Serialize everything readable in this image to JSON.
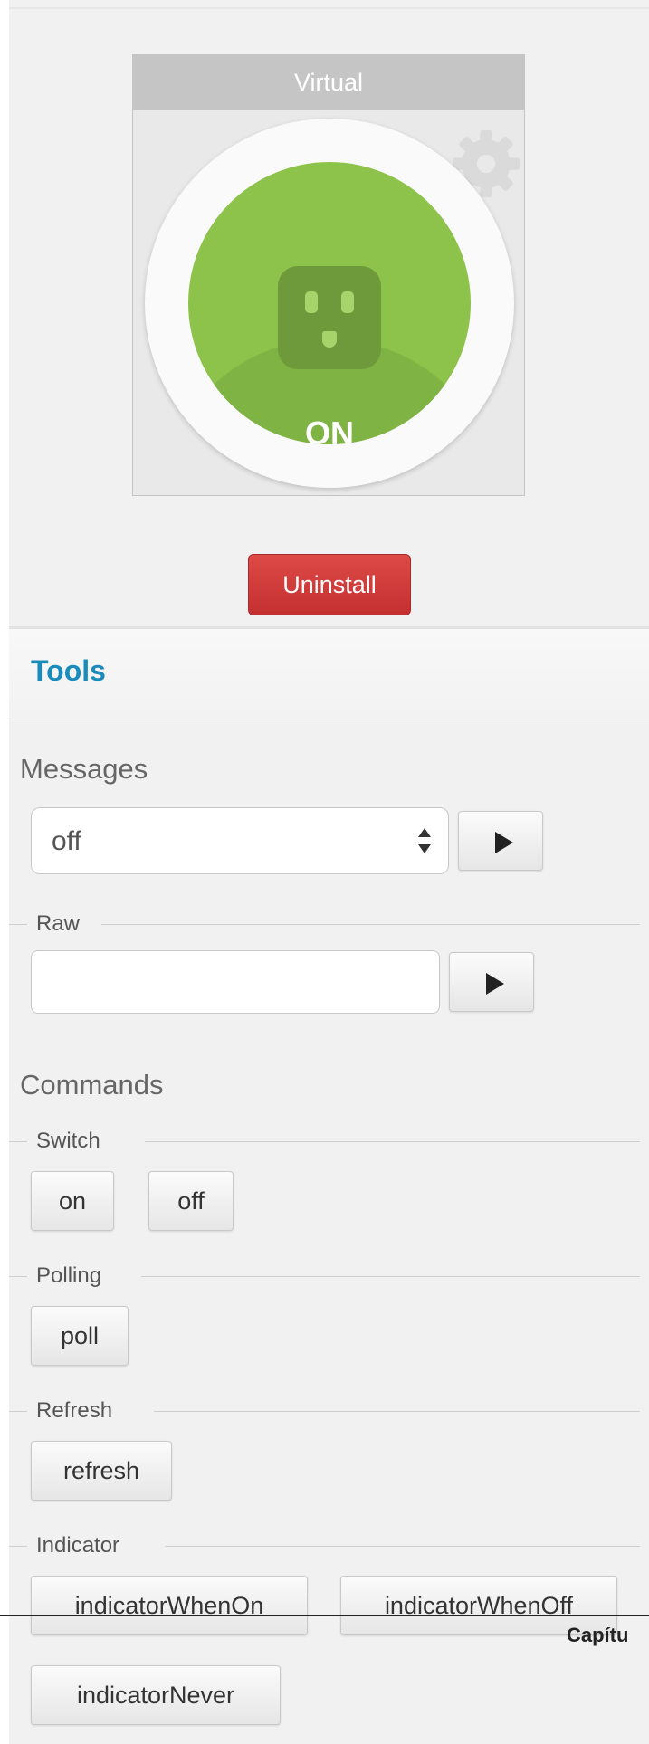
{
  "device_tile": {
    "label": "Virtual",
    "state": "ON"
  },
  "uninstall_label": "Uninstall",
  "tools": {
    "title": "Tools",
    "messages": {
      "heading": "Messages",
      "selected": "off",
      "raw_label": "Raw",
      "raw_value": ""
    },
    "commands": {
      "heading": "Commands",
      "groups": [
        {
          "label": "Switch",
          "buttons": [
            "on",
            "off"
          ]
        },
        {
          "label": "Polling",
          "buttons": [
            "poll"
          ]
        },
        {
          "label": "Refresh",
          "buttons": [
            "refresh"
          ]
        },
        {
          "label": "Indicator",
          "buttons": [
            "indicatorWhenOn",
            "indicatorWhenOff",
            "indicatorNever"
          ]
        }
      ]
    }
  },
  "page_footer": "Capítu",
  "colors": {
    "on_green": "#8dc34a",
    "uninstall_red": "#d03a37",
    "tools_blue": "#1a8bbd"
  }
}
